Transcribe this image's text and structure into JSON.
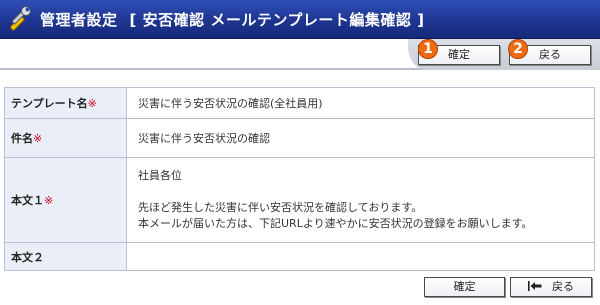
{
  "header": {
    "title": "管理者設定",
    "subtitle": "[ 安否確認 メールテンプレート編集確認 ]"
  },
  "top_buttons": {
    "confirm_label": "確定",
    "back_label": "戻る"
  },
  "markers": [
    "1",
    "2"
  ],
  "form": {
    "required_mark": "※",
    "rows": [
      {
        "label": "テンプレート名",
        "required": true,
        "value": "災害に伴う安否状況の確認(全社員用)"
      },
      {
        "label": "件名",
        "required": true,
        "value": "災害に伴う安否状況の確認"
      },
      {
        "label": "本文１",
        "required": true,
        "lines": [
          "社員各位",
          "",
          "先ほど発生した災害に伴い安否状況を確認しております。",
          "本メールが届いた方は、下記URLより速やかに安否状況の登録をお願いします。"
        ]
      },
      {
        "label": "本文２",
        "required": false,
        "value": ""
      }
    ]
  },
  "bottom_buttons": {
    "confirm_label": "確定",
    "back_label": "戻る"
  },
  "colors": {
    "header_bg": "#1e3590",
    "label_bg": "#e9eef7",
    "required": "#d0021b",
    "marker": "#f06a10"
  },
  "icons": [
    "tools-icon",
    "back-arrow-icon"
  ]
}
